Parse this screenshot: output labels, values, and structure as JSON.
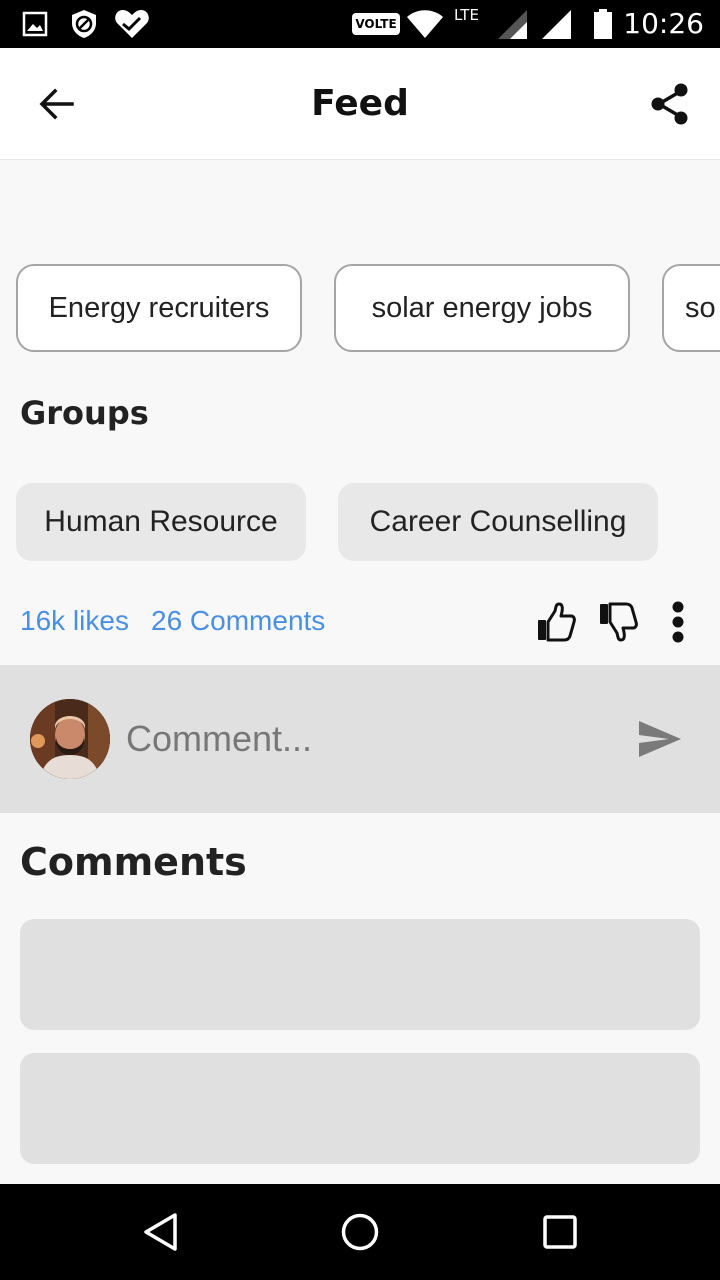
{
  "status_bar": {
    "time": "10:26",
    "volte": "VOLTE",
    "lte": "LTE",
    "icons": [
      "gallery-icon",
      "block-icon",
      "health-icon",
      "wifi-icon",
      "signal-icon",
      "signal-icon",
      "battery-icon"
    ]
  },
  "app_bar": {
    "title": "Feed",
    "back_icon": "arrow-back-icon",
    "share_icon": "share-icon"
  },
  "tags": [
    "Energy recruiters",
    "solar energy jobs",
    "so"
  ],
  "groups": {
    "title": "Groups",
    "items": [
      "Human Resource",
      "Career Counselling"
    ]
  },
  "stats": {
    "likes": "16k likes",
    "comments": "26 Comments"
  },
  "actions": [
    "thumbs-up-icon",
    "thumbs-down-icon",
    "more-vertical-icon"
  ],
  "comment_box": {
    "placeholder": "Comment...",
    "send_icon": "send-icon"
  },
  "comments_section": {
    "title": "Comments"
  },
  "nav_bar": [
    "back-triangle-icon",
    "home-circle-icon",
    "recents-square-icon"
  ],
  "colors": {
    "link": "#4a8fe0",
    "background": "#f8f8f8",
    "chip": "#e8e8e8",
    "comment_bar": "#e0e0e0"
  }
}
